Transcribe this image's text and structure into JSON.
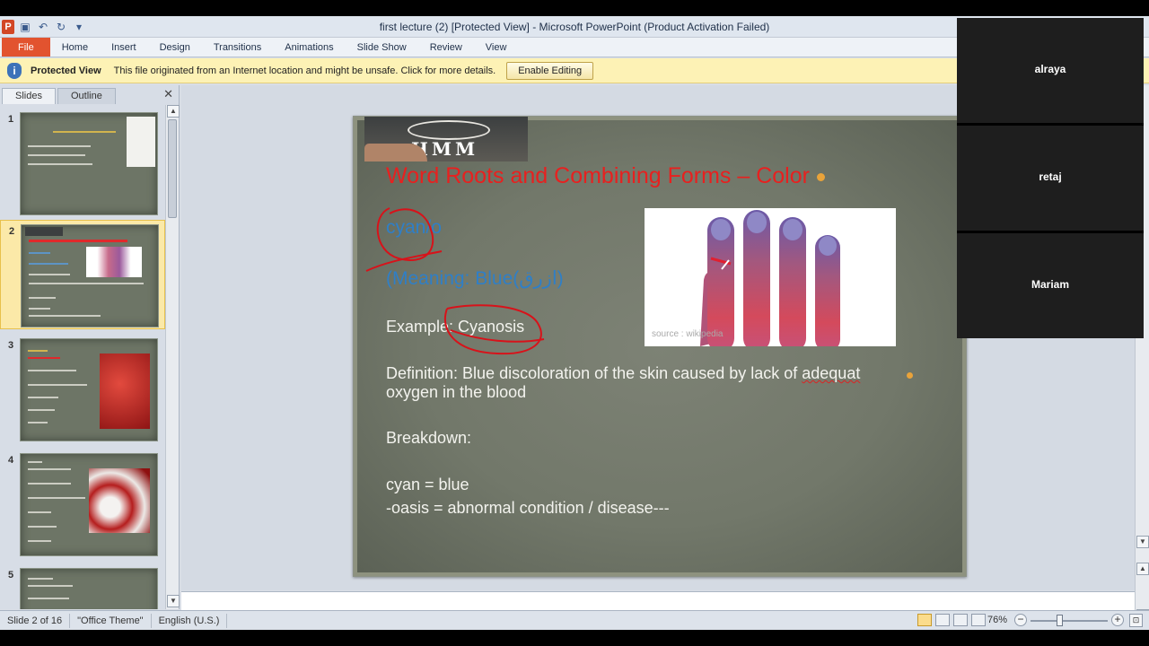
{
  "window": {
    "title": "first lecture (2) [Protected View]  -  Microsoft PowerPoint (Product Activation Failed)"
  },
  "ribbon": {
    "tabs": [
      "File",
      "Home",
      "Insert",
      "Design",
      "Transitions",
      "Animations",
      "Slide Show",
      "Review",
      "View"
    ]
  },
  "protected_view": {
    "title": "Protected View",
    "message": "This file originated from an Internet location and might be unsafe. Click for more details.",
    "button": "Enable Editing"
  },
  "left_pane": {
    "tabs": [
      "Slides",
      "Outline"
    ],
    "close": "✕",
    "thumbnails": [
      {
        "number": "1"
      },
      {
        "number": "2"
      },
      {
        "number": "3"
      },
      {
        "number": "4"
      },
      {
        "number": "5"
      }
    ]
  },
  "slide": {
    "logo_text": "HMM",
    "title": "Word Roots and Combining Forms – Color",
    "root_term": "cyan/o",
    "meaning": "(Meaning:  Blue(ازرق)",
    "example": "Example: Cyanosis",
    "definition_part1": "Definition: Blue discoloration of the skin caused by lack of ",
    "definition_misspelled": "adequat",
    "definition_line2": "oxygen in the blood",
    "breakdown_label": "Breakdown:",
    "breakdown_1": "cyan = blue",
    "breakdown_2": "-oasis = abnormal condition / disease---",
    "photo_caption": "source : wikipedia"
  },
  "status_bar": {
    "slide_info": "Slide 2 of 16",
    "theme": "\"Office Theme\"",
    "language": "English (U.S.)",
    "zoom": "76%",
    "zoom_level_percent": 76
  },
  "participants": [
    {
      "name": "alraya"
    },
    {
      "name": "retaj"
    },
    {
      "name": "Mariam"
    }
  ],
  "colors": {
    "title_red": "#e8201f",
    "accent_blue": "#2f7fc7",
    "file_tab": "#e2532f",
    "ink_red": "#d8121a"
  }
}
